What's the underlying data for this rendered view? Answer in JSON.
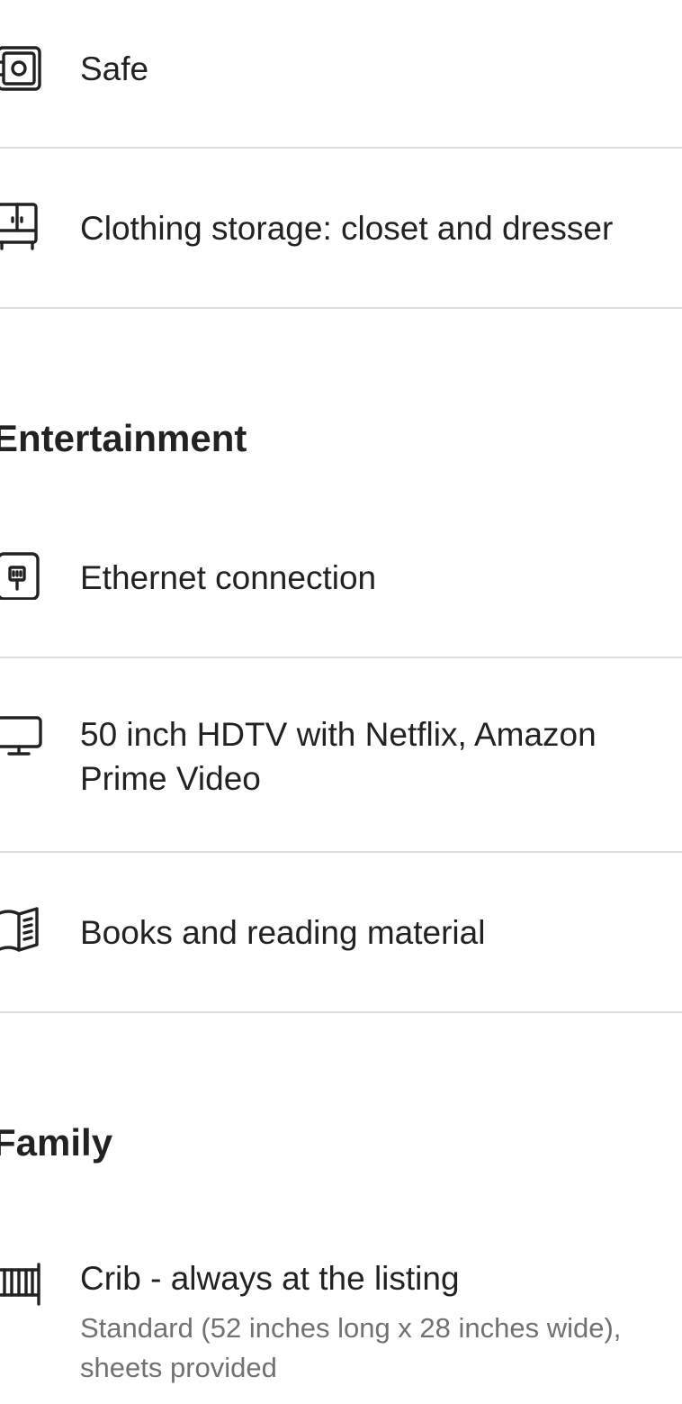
{
  "amenities": {
    "safe": {
      "label": "Safe",
      "icon": "safe-icon"
    },
    "clothing_storage": {
      "label": "Clothing storage: closet and dresser",
      "icon": "wardrobe-icon"
    },
    "entertainment": {
      "heading": "Entertainment",
      "ethernet": {
        "label": "Ethernet connection",
        "icon": "ethernet-icon"
      },
      "tv": {
        "label": "50 inch HDTV with Netflix, Amazon Prime Video",
        "icon": "tv-icon"
      },
      "books": {
        "label": "Books and reading material",
        "icon": "book-icon"
      }
    },
    "family": {
      "heading": "Family",
      "crib": {
        "label": "Crib - always at the listing",
        "detail": "Standard (52 inches long x 28 inches wide), sheets provided",
        "icon": "crib-icon"
      }
    }
  },
  "colors": {
    "text": "#222222",
    "secondary_text": "#717171",
    "divider": "#dddddd"
  }
}
